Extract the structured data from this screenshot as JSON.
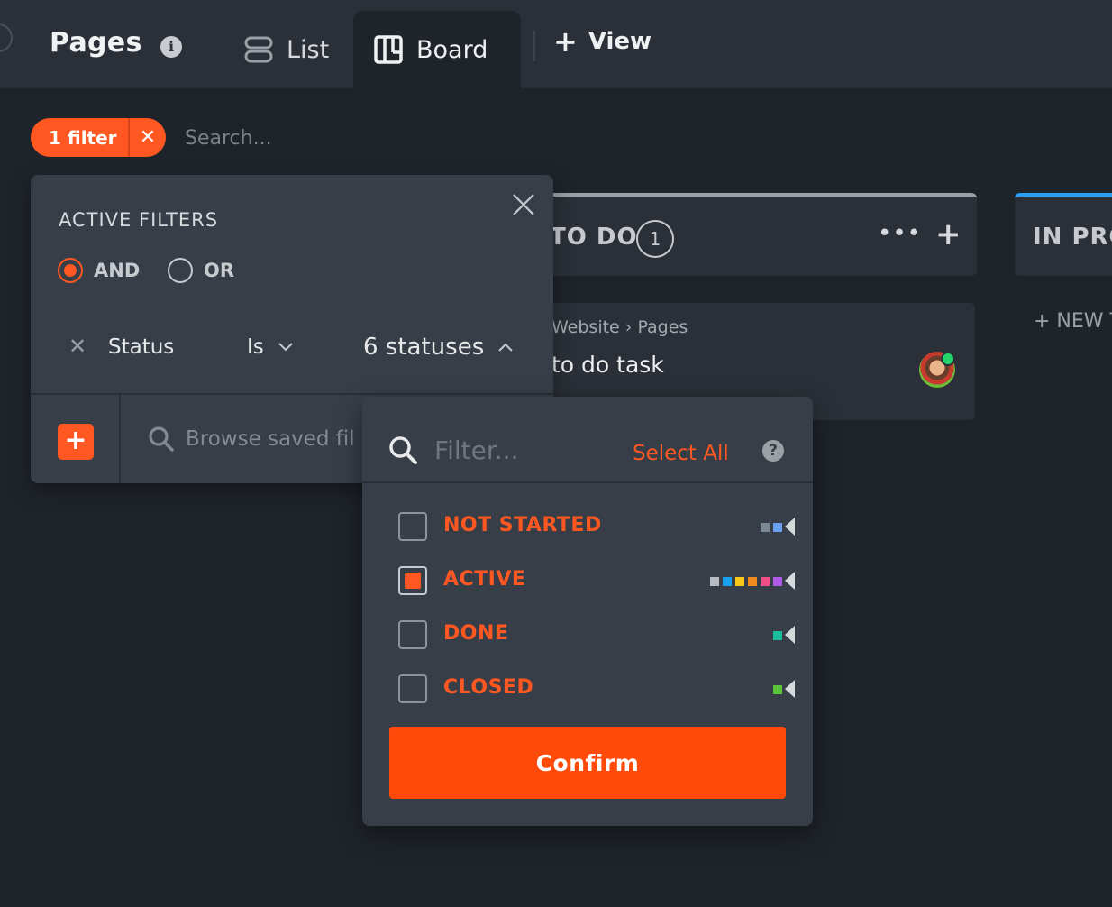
{
  "header": {
    "title": "Pages",
    "views": [
      {
        "label": "List"
      },
      {
        "label": "Board"
      }
    ],
    "add_view_label": "View"
  },
  "toolbar": {
    "filter_count_label": "1 filter",
    "search_placeholder": "Search..."
  },
  "board": {
    "columns": [
      {
        "title": "TO DO",
        "count": "1"
      },
      {
        "title": "IN PRO"
      }
    ],
    "card": {
      "breadcrumb_project": "Website",
      "breadcrumb_list": "Pages",
      "title": "to do task"
    },
    "new_task_label": "+ NEW T"
  },
  "filter_panel": {
    "title": "ACTIVE FILTERS",
    "logic": {
      "and_label": "AND",
      "or_label": "OR",
      "selected": "AND"
    },
    "rule": {
      "field": "Status",
      "operator": "Is",
      "value": "6 statuses"
    },
    "saved_filters_placeholder": "Browse saved fil"
  },
  "status_dropdown": {
    "filter_placeholder": "Filter...",
    "select_all_label": "Select All",
    "statuses": [
      {
        "label": "NOT STARTED",
        "checked": false,
        "colors": [
          "#7c8794",
          "#6aa0f0"
        ]
      },
      {
        "label": "ACTIVE",
        "checked": true,
        "colors": [
          "#b8bcc2",
          "#1aa1ef",
          "#f6c81a",
          "#f08a1c",
          "#ef4f86",
          "#b05ae8"
        ]
      },
      {
        "label": "DONE",
        "checked": false,
        "colors": [
          "#1abc9c"
        ]
      },
      {
        "label": "CLOSED",
        "checked": false,
        "colors": [
          "#5ac43a"
        ]
      }
    ],
    "confirm_label": "Confirm"
  },
  "colors": {
    "accent": "#ff5722",
    "confirm": "#ff4a0a",
    "background": "#1f242b",
    "panel": "#383e47"
  }
}
